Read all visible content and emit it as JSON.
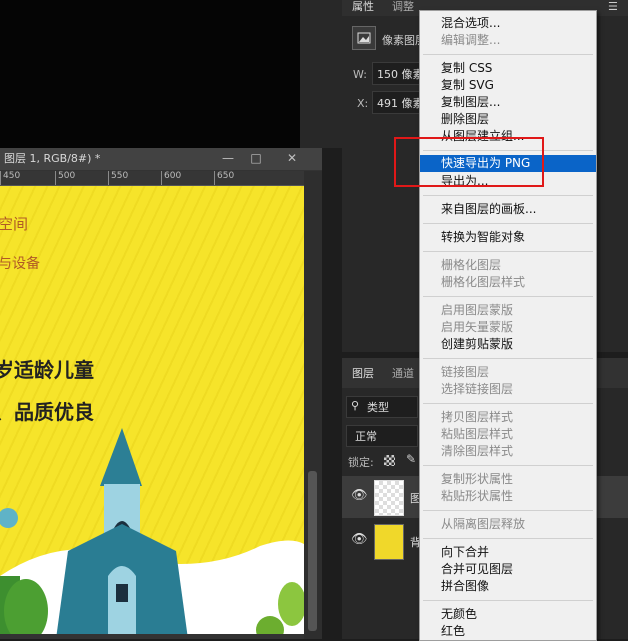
{
  "document": {
    "title": "图层 1, RGB/8#) *",
    "ruler_ticks": [
      "450",
      "500",
      "550",
      "600",
      "650"
    ],
    "canvas_texts": [
      "空间",
      "与设备",
      "岁适龄儿童",
      "、品质优良"
    ]
  },
  "properties_panel": {
    "tabs": [
      "属性",
      "调整"
    ],
    "layer_type": "像素图层",
    "w_label": "W:",
    "w_value": "150 像素",
    "x_label": "X:",
    "x_value": "491 像素"
  },
  "layers_panel": {
    "tabs": [
      "图层",
      "通道"
    ],
    "filter": "类型",
    "blend_mode": "正常",
    "lock_label": "锁定:",
    "layers": [
      {
        "name": "图"
      },
      {
        "name": "背"
      }
    ]
  },
  "context_menu": {
    "items": [
      {
        "label": "混合选项...",
        "disabled": false
      },
      {
        "label": "编辑调整...",
        "disabled": true
      },
      {
        "label": "复制 CSS",
        "disabled": false
      },
      {
        "label": "复制 SVG",
        "disabled": false
      },
      {
        "label": "复制图层...",
        "disabled": false
      },
      {
        "label": "删除图层",
        "disabled": false
      },
      {
        "label": "从图层建立组...",
        "disabled": false
      },
      {
        "label": "快速导出为 PNG",
        "disabled": false,
        "highlighted": true
      },
      {
        "label": "导出为...",
        "disabled": false
      },
      {
        "label": "来自图层的画板...",
        "disabled": false
      },
      {
        "label": "转换为智能对象",
        "disabled": false
      },
      {
        "label": "栅格化图层",
        "disabled": true
      },
      {
        "label": "栅格化图层样式",
        "disabled": true
      },
      {
        "label": "启用图层蒙版",
        "disabled": true
      },
      {
        "label": "启用矢量蒙版",
        "disabled": true
      },
      {
        "label": "创建剪贴蒙版",
        "disabled": false
      },
      {
        "label": "链接图层",
        "disabled": true
      },
      {
        "label": "选择链接图层",
        "disabled": true
      },
      {
        "label": "拷贝图层样式",
        "disabled": true
      },
      {
        "label": "粘贴图层样式",
        "disabled": true
      },
      {
        "label": "清除图层样式",
        "disabled": true
      },
      {
        "label": "复制形状属性",
        "disabled": true
      },
      {
        "label": "粘贴形状属性",
        "disabled": true
      },
      {
        "label": "从隔离图层释放",
        "disabled": true
      },
      {
        "label": "向下合并",
        "disabled": false
      },
      {
        "label": "合并可见图层",
        "disabled": false
      },
      {
        "label": "拼合图像",
        "disabled": false
      },
      {
        "label": "无颜色",
        "disabled": false
      },
      {
        "label": "红色",
        "disabled": false
      }
    ]
  },
  "colors": {
    "highlight": "#0a64c8",
    "annotation_box": "#e01818",
    "canvas_yellow": "#f6e42a"
  }
}
